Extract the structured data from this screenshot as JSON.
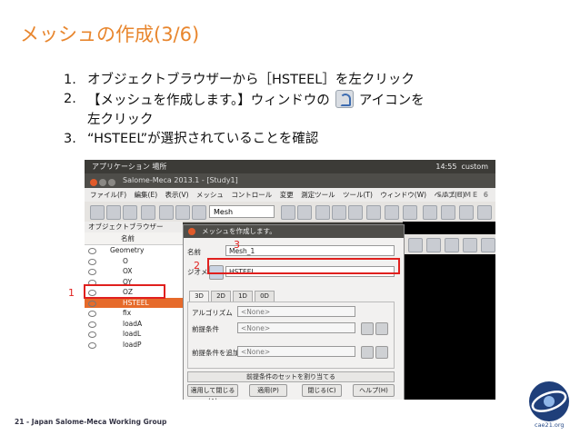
{
  "slide": {
    "title": "メッシュの作成(3/6)",
    "steps": [
      {
        "num": "1.",
        "text": "オブジェクトブラウザーから［HSTEEL］を左クリック"
      },
      {
        "num": "2.",
        "text_before": "【メッシュを作成します。】ウィンドウの",
        "text_after": "アイコンを",
        "line2": "左クリック"
      },
      {
        "num": "3.",
        "text": "“HSTEEL”が選択されていることを確認"
      }
    ],
    "footer": "21 - Japan Salome-Meca Working Group",
    "logo_text": "cae21.org"
  },
  "screenshot": {
    "topbar": {
      "apps": "アプリケーション 場所",
      "time": "14:55",
      "user": "custom"
    },
    "window_title": "Salome-Meca 2013.1 - [Study1]",
    "menu": [
      "ファイル(F)",
      "編集(E)",
      "表示(V)",
      "メッシュ",
      "コントロール",
      "変更",
      "測定ツール",
      "ツール(T)",
      "ウィンドウ(W)",
      "ヘルプ(H)"
    ],
    "menu_logo": "SALOME 6",
    "module": "Mesh",
    "object_browser": {
      "title": "オブジェクトブラウザー",
      "column_name": "名前",
      "items": [
        {
          "label": "Geometry",
          "indent": 1
        },
        {
          "label": "O",
          "indent": 2
        },
        {
          "label": "OX",
          "indent": 2
        },
        {
          "label": "OY",
          "indent": 2
        },
        {
          "label": "OZ",
          "indent": 2
        },
        {
          "label": "HSTEEL",
          "indent": 2,
          "selected": true
        },
        {
          "label": "fix",
          "indent": 2
        },
        {
          "label": "loadA",
          "indent": 2
        },
        {
          "label": "loadL",
          "indent": 2
        },
        {
          "label": "loadP",
          "indent": 2
        }
      ]
    },
    "dialog": {
      "title": "メッシュを作成します。",
      "name_label": "名前",
      "name_value": "Mesh_1",
      "geometry_label": "ジオメトリ",
      "geometry_value": "HSTEEL",
      "tabs": [
        "3D",
        "2D",
        "1D",
        "0D"
      ],
      "algorithm_label": "アルゴリズム",
      "algorithm_value": "<None>",
      "hypothesis_label": "前提条件",
      "hypothesis_value": "<None>",
      "add_hypothesis_label": "前提条件を追加",
      "add_hypothesis_value": "<None>",
      "assign_set_button": "前提条件のセットを割り当てる",
      "buttons": [
        "適用して閉じる(A)",
        "適用(P)",
        "閉じる(C)",
        "ヘルプ(H)"
      ]
    },
    "callouts": [
      "1",
      "2",
      "3"
    ]
  },
  "colors": {
    "title": "#e8862e",
    "callout": "#e0201e",
    "selection": "#e66a2a"
  }
}
